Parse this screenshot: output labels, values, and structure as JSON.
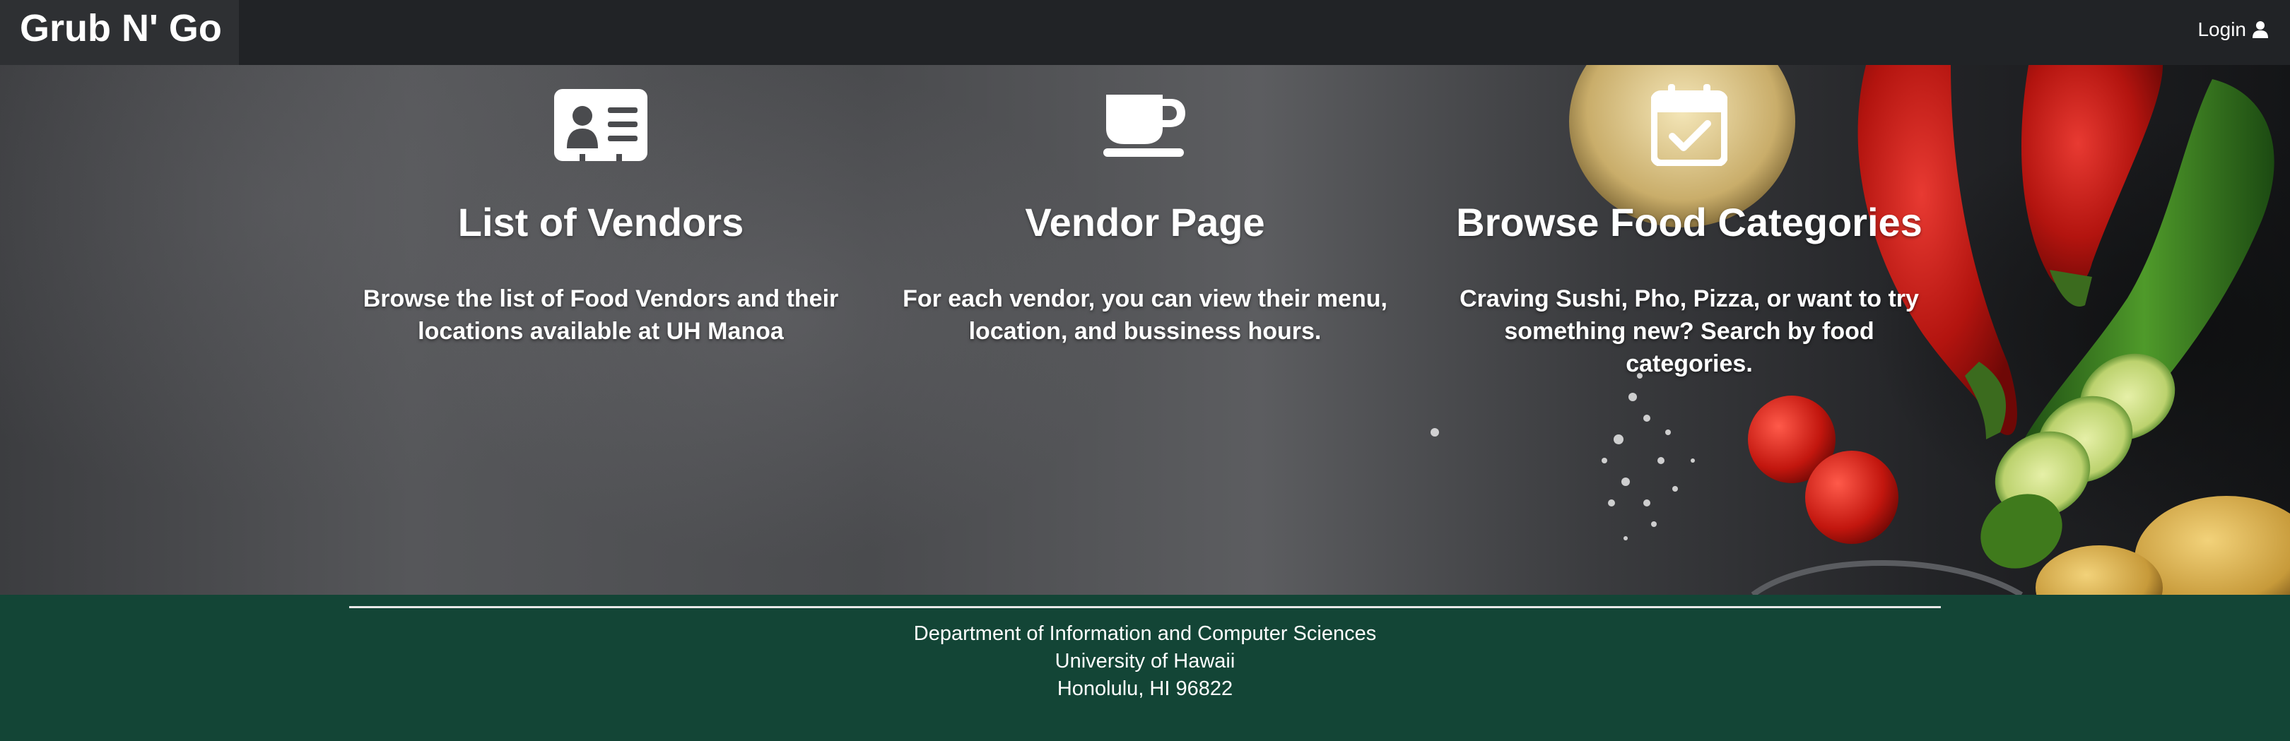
{
  "navbar": {
    "brand": "Grub N' Go",
    "login_label": "Login",
    "login_icon": "user-icon",
    "background": "#212326"
  },
  "features": [
    {
      "icon": "address-card-icon",
      "title": "List of Vendors",
      "description": "Browse the list of Food Vendors and their locations available at UH Manoa"
    },
    {
      "icon": "coffee-cup-icon",
      "title": "Vendor Page",
      "description": "For each vendor, you can view their menu, location, and bussiness hours."
    },
    {
      "icon": "calendar-check-icon",
      "title": "Browse Food Categories",
      "description": "Craving Sushi, Pho, Pizza, or want to try something new? Search by food categories."
    }
  ],
  "footer": {
    "line1": "Department of Information and Computer Sciences",
    "line2": "University of Hawaii",
    "line3": "Honolulu, HI 96822",
    "background": "#134536"
  }
}
